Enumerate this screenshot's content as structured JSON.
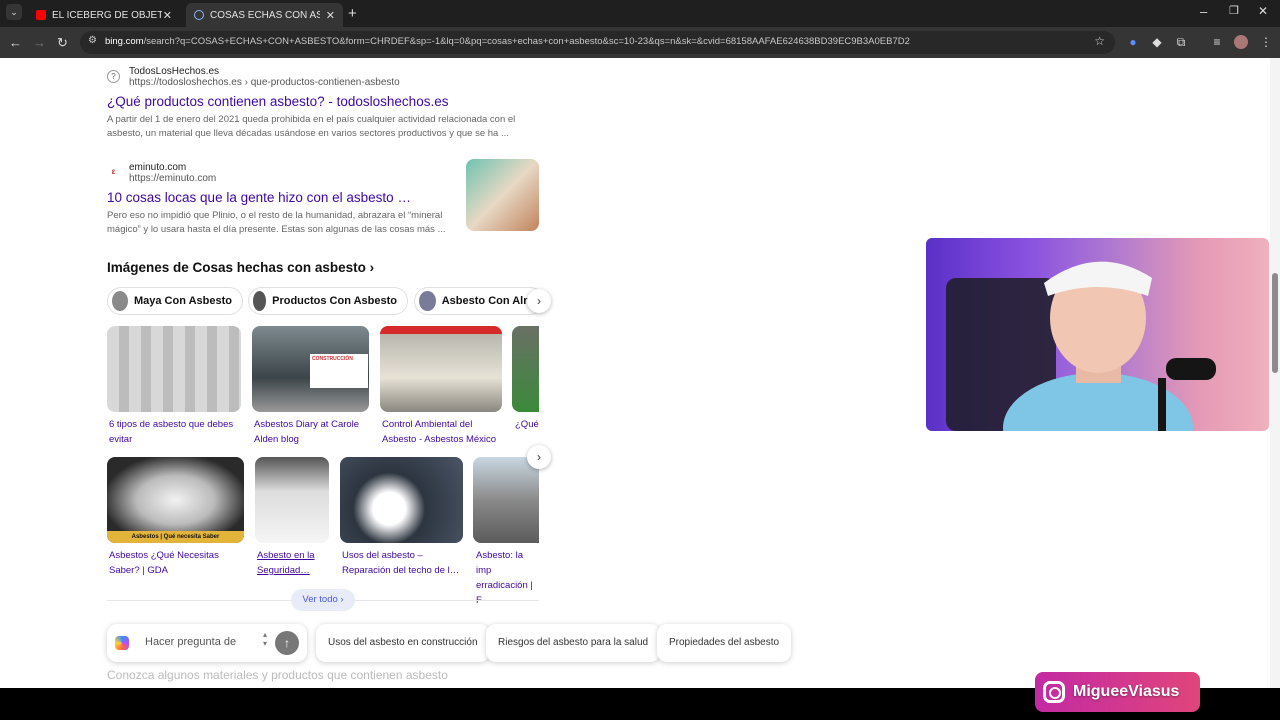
{
  "browser": {
    "tabs": [
      {
        "label": "EL ICEBERG DE OBJETOS PELIGR",
        "active": false,
        "icon": "youtube-icon"
      },
      {
        "label": "COSAS ECHAS CON ASBESTO -",
        "active": true,
        "icon": "search-icon"
      }
    ],
    "url_host": "bing.com",
    "url_rest": "/search?q=COSAS+ECHAS+CON+ASBESTO&form=CHRDEF&sp=-1&lq=0&pq=cosas+echas+con+asbesto&sc=10-23&qs=n&sk=&cvid=68158AAFAE624638BD39EC9B3A0EB7D2"
  },
  "results": [
    {
      "site_name": "TodosLosHechos.es",
      "site_url": "https://todosloshechos.es › que-productos-contienen-asbesto",
      "title": "¿Qué productos contienen asbesto? - todosloshechos.es",
      "snippet": "A partir del 1 de enero del 2021 queda prohibida en el país cualquier actividad relacionada con el asbesto, un material que lleva décadas usándose en varios sectores productivos y que se ha ..."
    },
    {
      "site_name": "eminuto.com",
      "site_url": "https://eminuto.com",
      "title": "10 cosas locas que la gente hizo con el asbesto …",
      "snippet": "Pero eso no impidió que Plinio, o el resto de la humanidad, abrazara el “mineral mágico” y lo usara hasta el día presente. Estas son algunas de las cosas más ..."
    }
  ],
  "images_section": {
    "title": "Imágenes de Cosas hechas con asbesto",
    "chips": [
      "Maya Con Asbesto",
      "Productos Con Asbesto",
      "Asbesto Con Alm"
    ],
    "row1": [
      "6 tipos de asbesto que debes evitar",
      "Asbestos Diary at Carole Alden blog",
      "Control Ambiental del Asbesto - Asbestos México",
      "¿Qué"
    ],
    "row2": [
      "Asbestos ¿Qué Necesitas Saber? | GDA",
      "Asbesto en la Seguridad…",
      "Usos del asbesto – Reparación del techo de l…",
      "Asbesto: la imp erradicación | F"
    ],
    "banner_text": "Asbestos | Qué necesita Saber",
    "ver_todo": "Ver todo"
  },
  "copilot": {
    "placeholder": "Hacer pregunta de",
    "suggestions": [
      "Usos del asbesto en construcción",
      "Riesgos del asbesto para la salud",
      "Propiedades del asbesto"
    ]
  },
  "faded_text": "Conozca algunos materiales y productos que contienen asbesto",
  "overlay": {
    "instagram_handle": "MigueeViasus"
  },
  "colors": {
    "link": "#4007a2",
    "chrome_dark": "#1f1f1f",
    "chrome_bar": "#353535"
  }
}
